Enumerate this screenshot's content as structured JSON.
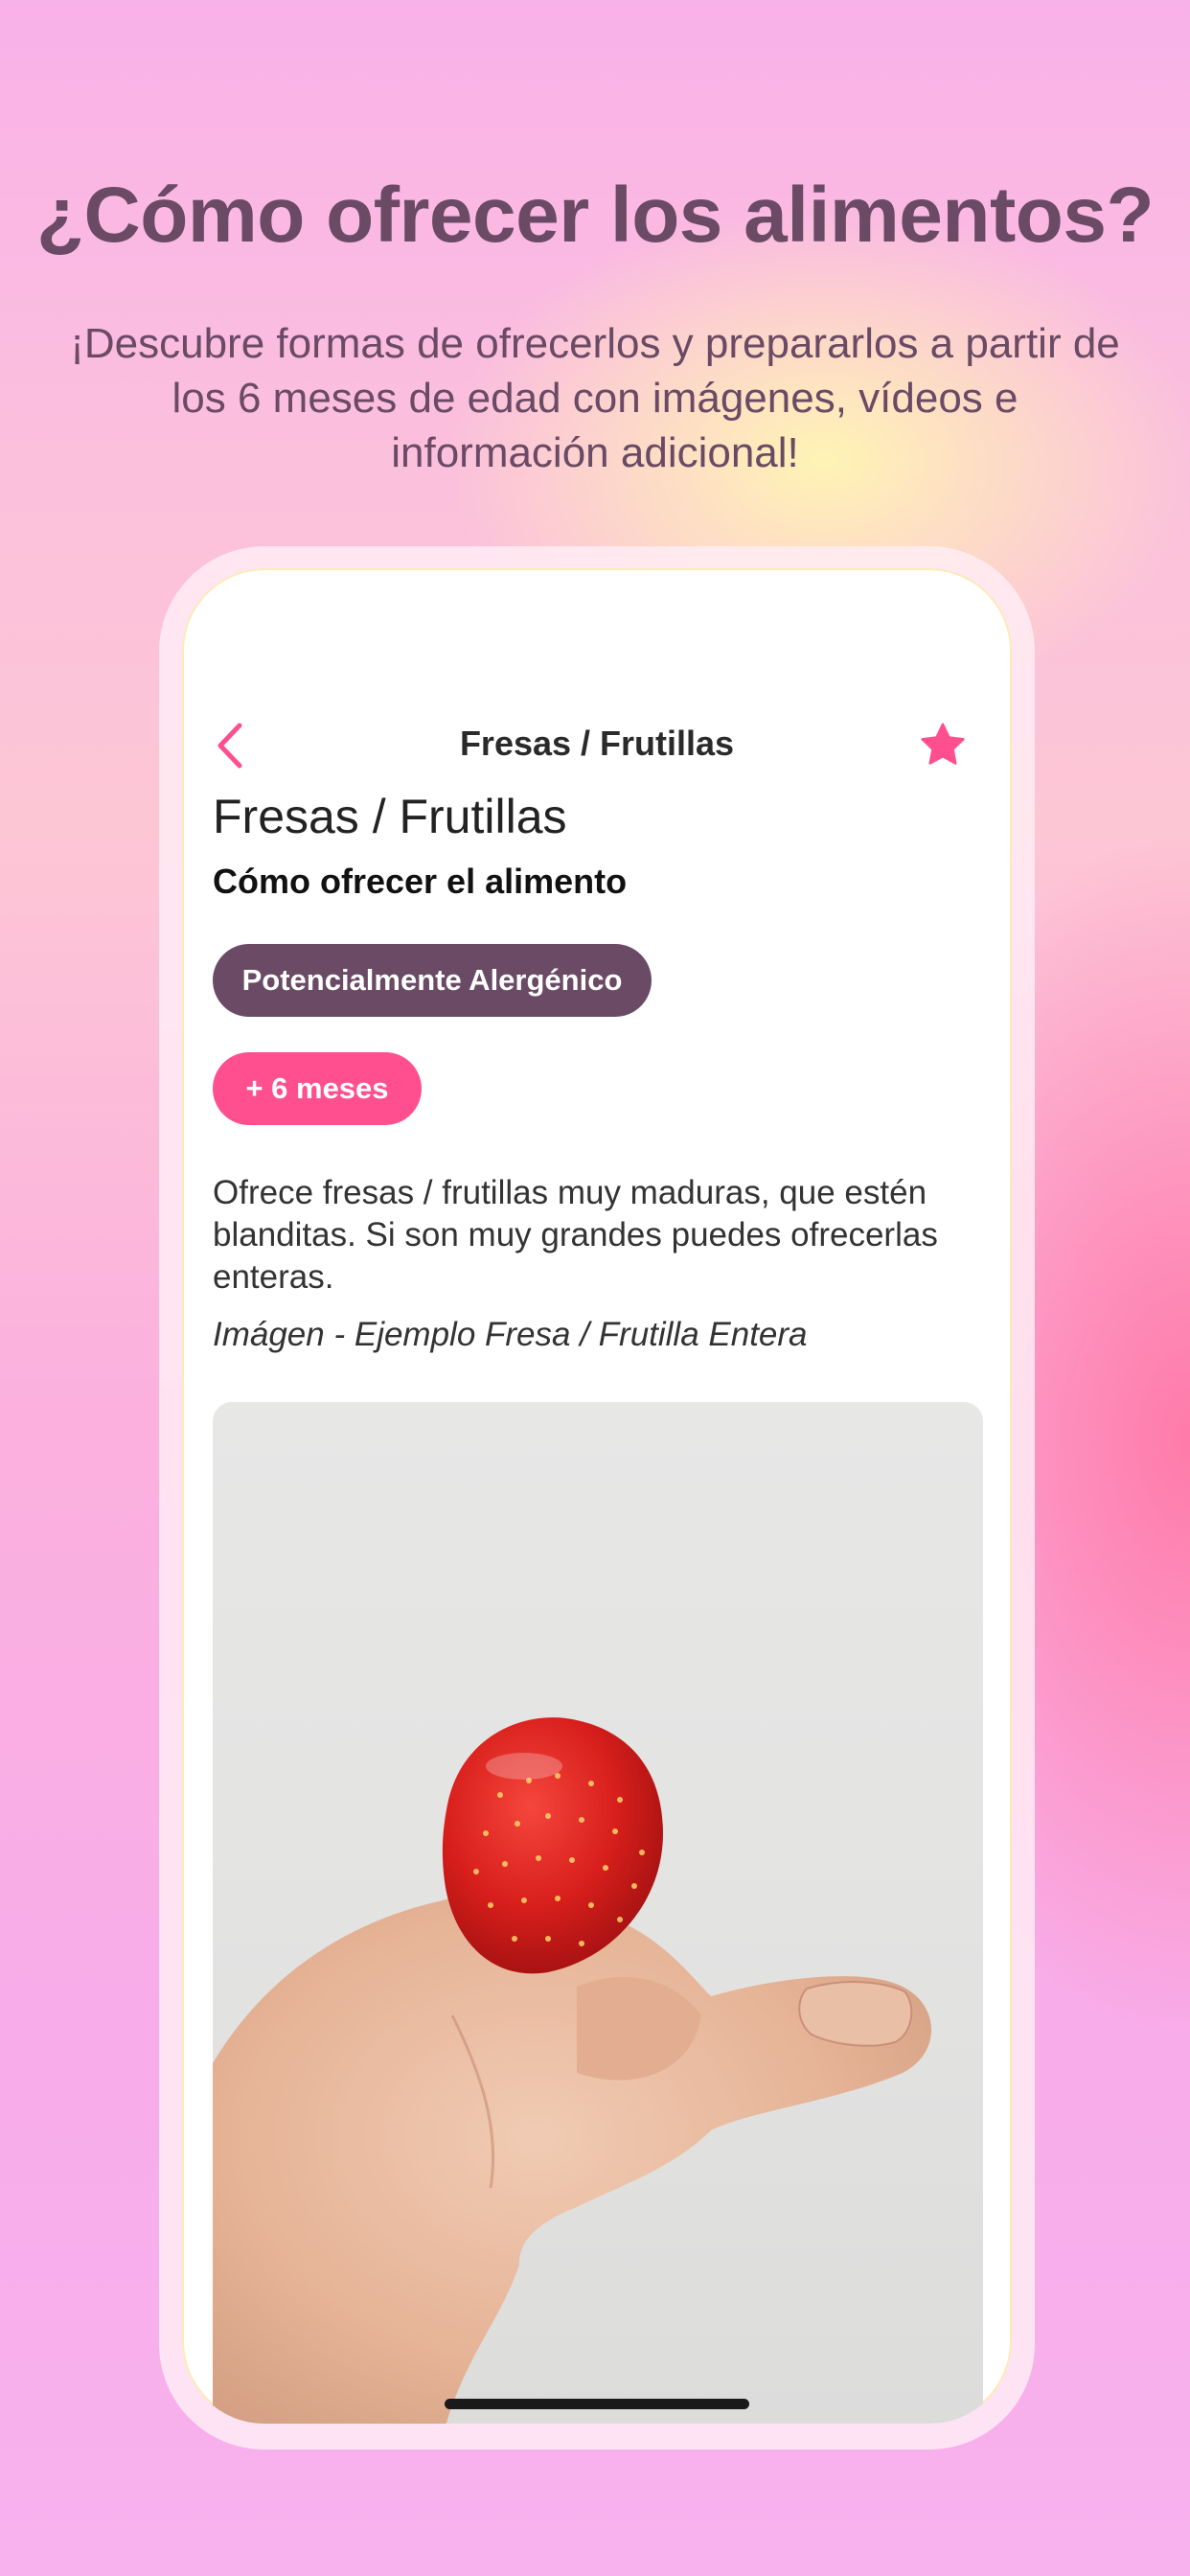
{
  "promo": {
    "headline": "¿Cómo ofrecer los alimentos?",
    "subheadline": "¡Descubre formas de ofrecerlos y prepararlos a partir de los 6 meses de edad con imágenes, vídeos e información adicional!"
  },
  "app": {
    "nav": {
      "title": "Fresas / Frutillas",
      "back_icon": "chevron-left-icon",
      "favorite_icon": "star-icon"
    },
    "food_title": "Fresas / Frutillas",
    "section_title": "Cómo ofrecer el alimento",
    "tags": {
      "allergen": "Potencialmente Alergénico",
      "age": "+ 6 meses"
    },
    "description": "Ofrece fresas / frutillas  muy maduras, que estén blanditas. Si son muy grandes puedes ofrecerlas enteras.",
    "image_caption": "Imágen - Ejemplo Fresa / Frutilla Entera"
  },
  "colors": {
    "accent_pink": "#ff4f8f",
    "allergen_purple": "#6a4a64",
    "headline_text": "#6a4a64"
  }
}
